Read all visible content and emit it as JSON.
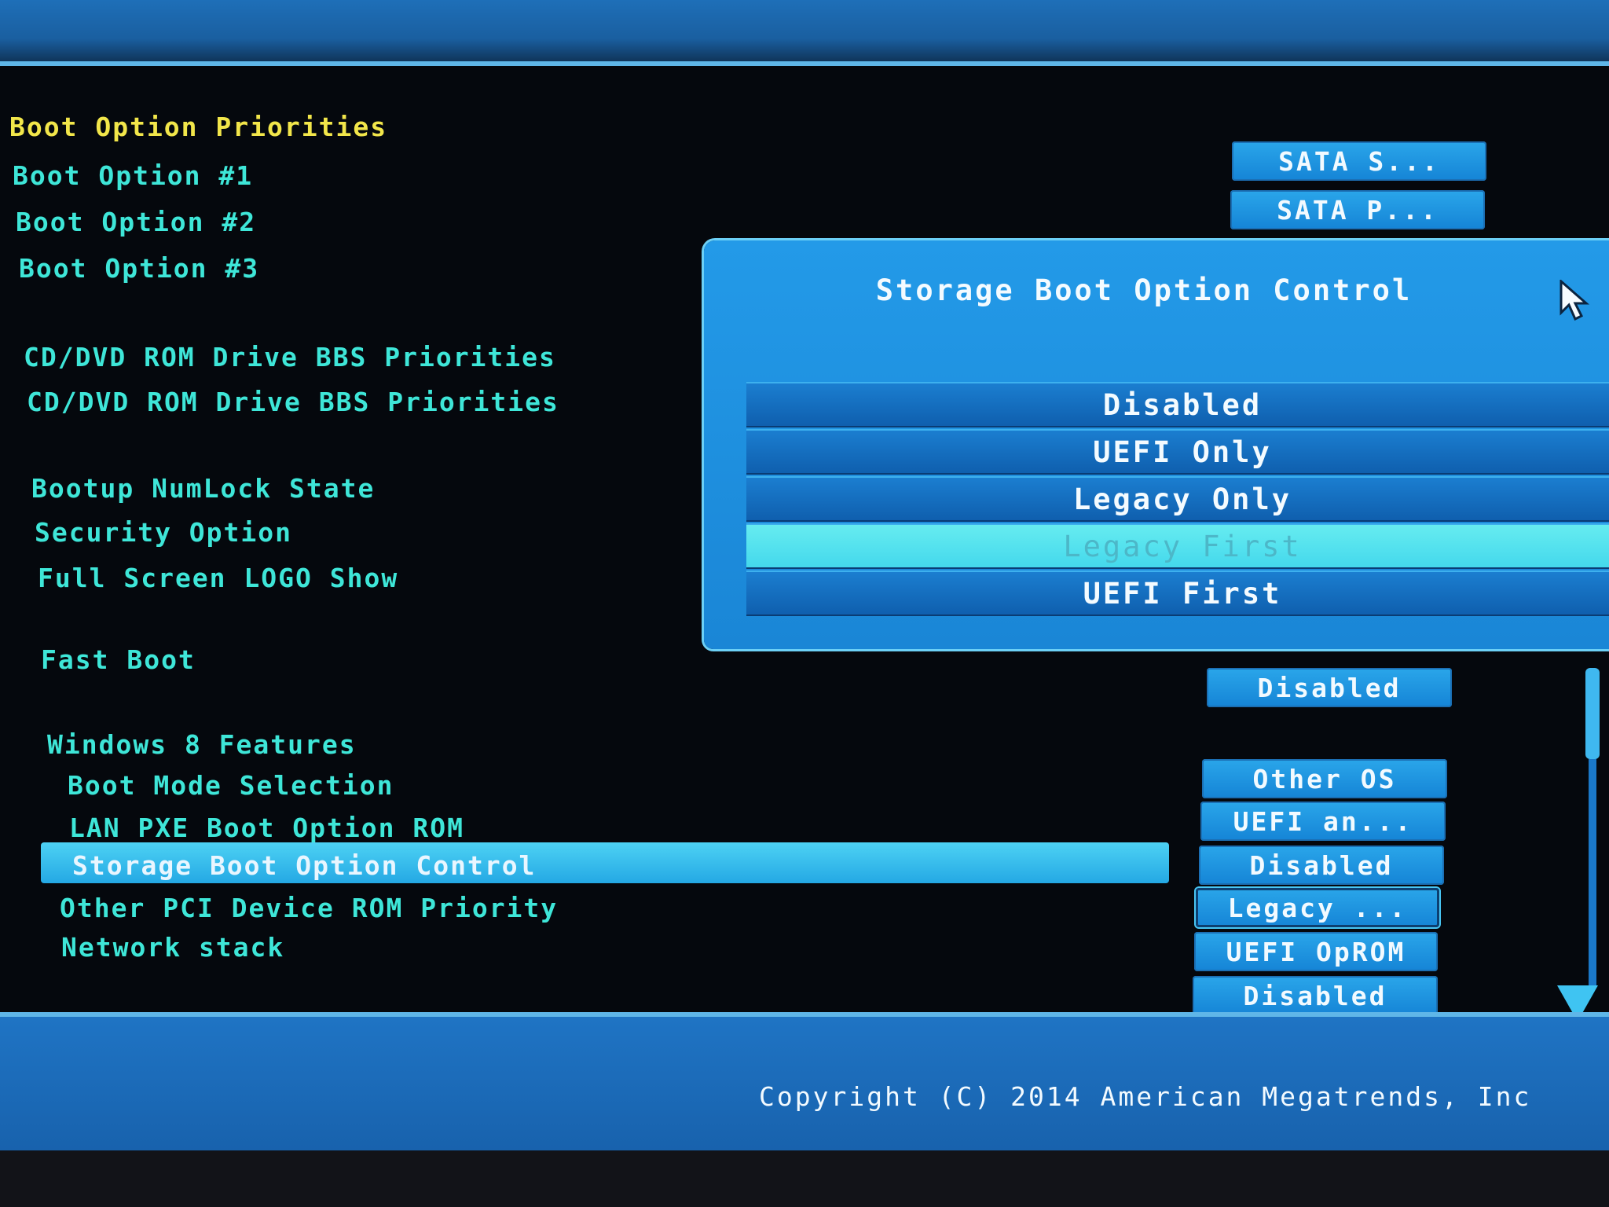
{
  "boot": {
    "section_title": "Boot Option Priorities",
    "option1_label": "Boot Option #1",
    "option2_label": "Boot Option #2",
    "option3_label": "Boot Option #3",
    "option1_value": "SATA  S...",
    "option2_value": "SATA  P..."
  },
  "cd_dvd": {
    "priorities_1": "CD/DVD ROM Drive BBS Priorities",
    "priorities_2": "CD/DVD ROM Drive BBS Priorities"
  },
  "misc": {
    "numlock_label": "Bootup NumLock State",
    "security_label": "Security Option",
    "logo_label": "Full Screen LOGO Show",
    "fast_boot_label": "Fast Boot",
    "fast_boot_value": "Disabled"
  },
  "win8": {
    "section_title": "Windows 8 Features",
    "boot_mode_label": "Boot Mode Selection",
    "boot_mode_value": "Other OS",
    "lan_pxe_label": "LAN PXE Boot Option ROM",
    "lan_pxe_value": "UEFI an...",
    "storage_label": "Storage Boot Option Control",
    "storage_value": "Disabled",
    "other_pci_label": "Other PCI Device ROM Priority",
    "other_pci_value": "Legacy ...",
    "network_label": "Network stack",
    "network_value": "UEFI OpROM",
    "extra_value": "Disabled"
  },
  "popup": {
    "title": "Storage Boot Option Control",
    "options": [
      "Disabled",
      "UEFI Only",
      "Legacy Only",
      "Legacy First",
      "UEFI First"
    ],
    "highlighted": "Legacy First"
  },
  "footer": {
    "copyright": "Copyright (C) 2014 American Megatrends, Inc"
  },
  "colors": {
    "label": "#3ee6d8",
    "title": "#f2e64a",
    "accent": "#1a86d6",
    "highlight": "#44d8ec"
  }
}
